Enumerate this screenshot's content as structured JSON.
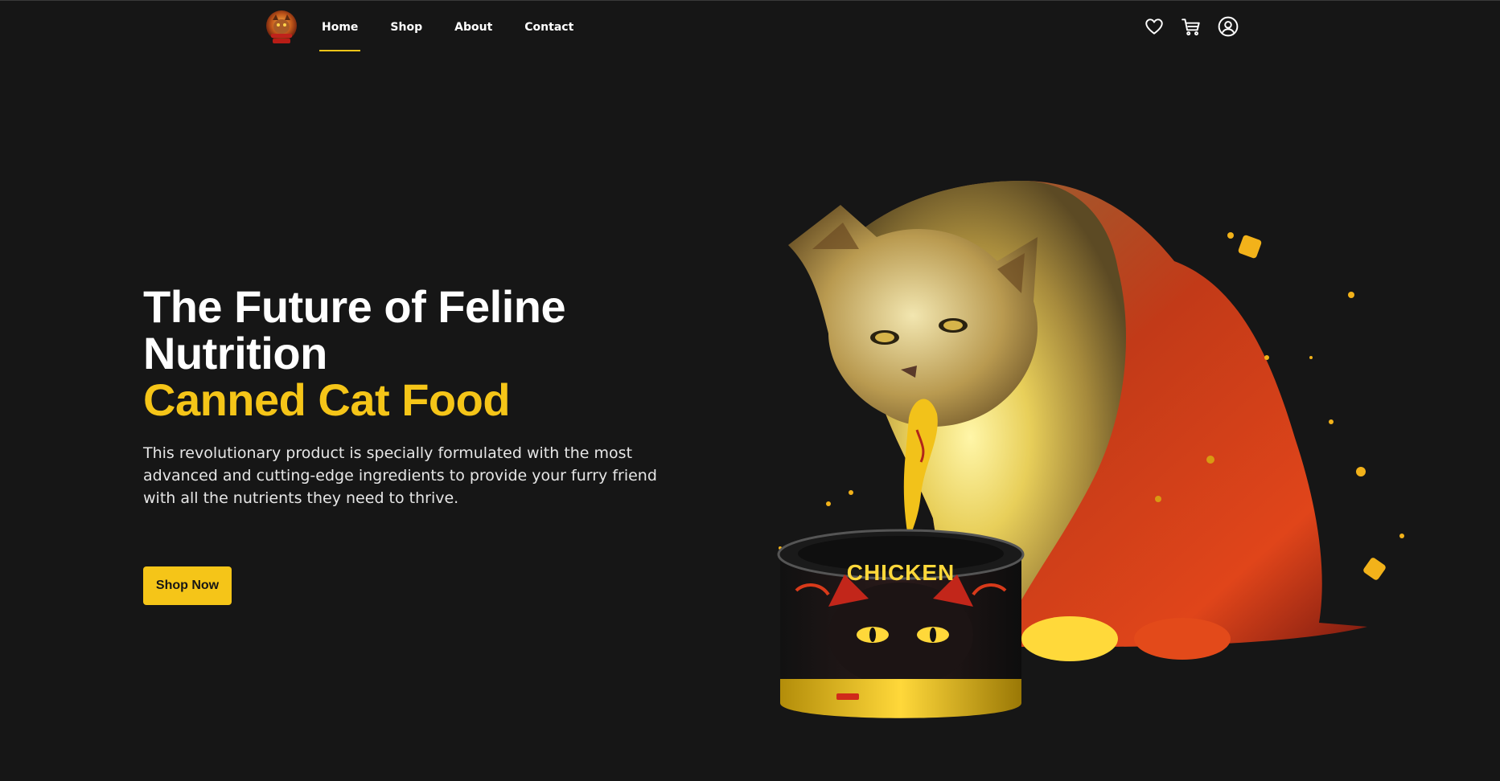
{
  "header": {
    "nav": [
      {
        "label": "Home",
        "active": true
      },
      {
        "label": "Shop",
        "active": false
      },
      {
        "label": "About",
        "active": false
      },
      {
        "label": "Contact",
        "active": false
      }
    ],
    "icons": [
      "heart-icon",
      "cart-icon",
      "user-icon"
    ]
  },
  "hero": {
    "title_line1": "The Future of Feline",
    "title_line2": "Nutrition",
    "title_accent": "Canned Cat Food",
    "description": "This revolutionary product is specially formulated with the most advanced and cutting-edge ingredients to provide your furry friend with all the nutrients they need to thrive.",
    "cta_label": "Shop Now",
    "can_label": "CHICKEN"
  },
  "colors": {
    "background": "#161616",
    "accent": "#f5c518",
    "text": "#ffffff"
  }
}
